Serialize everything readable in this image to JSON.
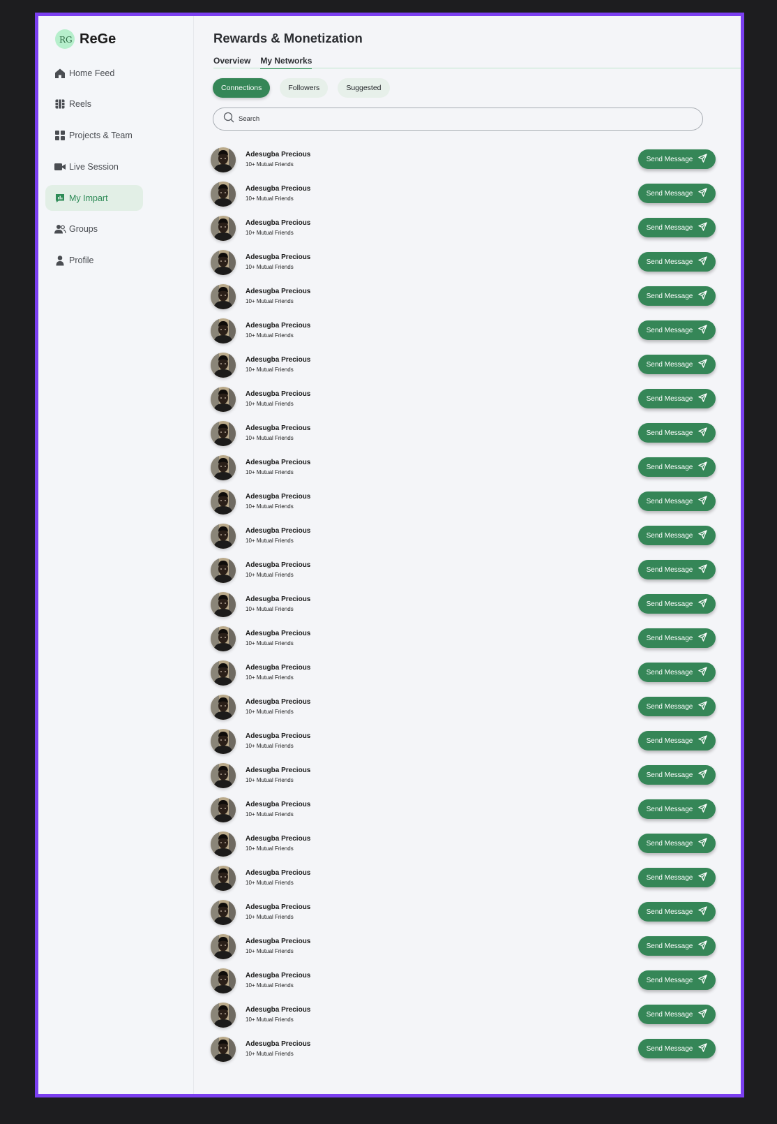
{
  "app": {
    "name": "ReGe",
    "logo_letters": "RG"
  },
  "colors": {
    "accent": "#358657",
    "frame": "#7b3ff0",
    "active_nav_bg": "#e2efe6"
  },
  "sidebar": {
    "items": [
      {
        "label": "Home Feed",
        "icon": "home-icon"
      },
      {
        "label": "Reels",
        "icon": "reels-icon"
      },
      {
        "label": "Projects & Team",
        "icon": "grid-icon"
      },
      {
        "label": "Live Session",
        "icon": "video-icon"
      },
      {
        "label": "My Impart",
        "icon": "chart-icon",
        "active": true
      },
      {
        "label": "Groups",
        "icon": "users-icon"
      },
      {
        "label": "Profile",
        "icon": "user-icon"
      }
    ]
  },
  "header": {
    "title": "Rewards & Monetization",
    "tabs": [
      {
        "label": "Overview"
      },
      {
        "label": "My Networks",
        "active": true
      }
    ]
  },
  "filters": [
    {
      "label": "Connections",
      "active": true
    },
    {
      "label": "Followers"
    },
    {
      "label": "Suggested"
    }
  ],
  "search": {
    "placeholder": "Search"
  },
  "people": [
    {
      "name": "Adesugba Precious",
      "subtitle": "10+ Mutual Friends",
      "action": "Send Message"
    },
    {
      "name": "Adesugba Precious",
      "subtitle": "10+ Mutual Friends",
      "action": "Send Message"
    },
    {
      "name": "Adesugba Precious",
      "subtitle": "10+ Mutual Friends",
      "action": "Send Message"
    },
    {
      "name": "Adesugba Precious",
      "subtitle": "10+ Mutual Friends",
      "action": "Send Message"
    },
    {
      "name": "Adesugba Precious",
      "subtitle": "10+ Mutual Friends",
      "action": "Send Message"
    },
    {
      "name": "Adesugba Precious",
      "subtitle": "10+ Mutual Friends",
      "action": "Send Message"
    },
    {
      "name": "Adesugba Precious",
      "subtitle": "10+ Mutual Friends",
      "action": "Send Message"
    },
    {
      "name": "Adesugba Precious",
      "subtitle": "10+ Mutual Friends",
      "action": "Send Message"
    },
    {
      "name": "Adesugba Precious",
      "subtitle": "10+ Mutual Friends",
      "action": "Send Message"
    },
    {
      "name": "Adesugba Precious",
      "subtitle": "10+ Mutual Friends",
      "action": "Send Message"
    },
    {
      "name": "Adesugba Precious",
      "subtitle": "10+ Mutual Friends",
      "action": "Send Message"
    },
    {
      "name": "Adesugba Precious",
      "subtitle": "10+ Mutual Friends",
      "action": "Send Message"
    },
    {
      "name": "Adesugba Precious",
      "subtitle": "10+ Mutual Friends",
      "action": "Send Message"
    },
    {
      "name": "Adesugba Precious",
      "subtitle": "10+ Mutual Friends",
      "action": "Send Message"
    },
    {
      "name": "Adesugba Precious",
      "subtitle": "10+ Mutual Friends",
      "action": "Send Message"
    },
    {
      "name": "Adesugba Precious",
      "subtitle": "10+ Mutual Friends",
      "action": "Send Message"
    },
    {
      "name": "Adesugba Precious",
      "subtitle": "10+ Mutual Friends",
      "action": "Send Message"
    },
    {
      "name": "Adesugba Precious",
      "subtitle": "10+ Mutual Friends",
      "action": "Send Message"
    },
    {
      "name": "Adesugba Precious",
      "subtitle": "10+ Mutual Friends",
      "action": "Send Message"
    },
    {
      "name": "Adesugba Precious",
      "subtitle": "10+ Mutual Friends",
      "action": "Send Message"
    },
    {
      "name": "Adesugba Precious",
      "subtitle": "10+ Mutual Friends",
      "action": "Send Message"
    },
    {
      "name": "Adesugba Precious",
      "subtitle": "10+ Mutual Friends",
      "action": "Send Message"
    },
    {
      "name": "Adesugba Precious",
      "subtitle": "10+ Mutual Friends",
      "action": "Send Message"
    },
    {
      "name": "Adesugba Precious",
      "subtitle": "10+ Mutual Friends",
      "action": "Send Message"
    },
    {
      "name": "Adesugba Precious",
      "subtitle": "10+ Mutual Friends",
      "action": "Send Message"
    },
    {
      "name": "Adesugba Precious",
      "subtitle": "10+ Mutual Friends",
      "action": "Send Message"
    },
    {
      "name": "Adesugba Precious",
      "subtitle": "10+ Mutual Friends",
      "action": "Send Message"
    }
  ]
}
